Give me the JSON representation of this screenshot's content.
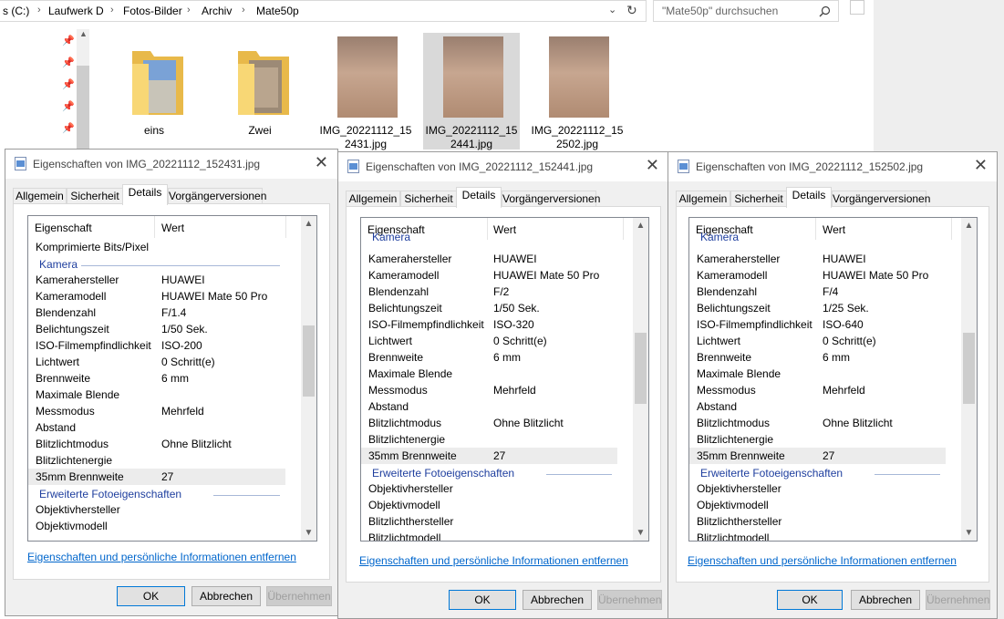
{
  "explorer": {
    "breadcrumb": [
      "s (C:)",
      "Laufwerk D",
      "Fotos-Bilder",
      "Archiv",
      "Mate50p"
    ],
    "search_placeholder": "\"Mate50p\" durchsuchen",
    "files": [
      {
        "label": "eins",
        "type": "folder"
      },
      {
        "label": "Zwei",
        "type": "folder"
      },
      {
        "label": "IMG_20221112_15\n2431.jpg",
        "type": "image"
      },
      {
        "label": "IMG_20221112_15\n2441.jpg",
        "type": "image",
        "selected": true
      },
      {
        "label": "IMG_20221112_15\n2502.jpg",
        "type": "image"
      }
    ]
  },
  "common": {
    "tabs": [
      "Allgemein",
      "Sicherheit",
      "Details",
      "Vorgängerversionen"
    ],
    "col_property": "Eigenschaft",
    "col_value": "Wert",
    "remove_link": "Eigenschaften und persönliche Informationen entfernen",
    "ok": "OK",
    "cancel": "Abbrechen",
    "apply": "Übernehmen"
  },
  "dialogs": [
    {
      "title": "Eigenschaften von IMG_20221112_152431.jpg",
      "rows": [
        {
          "p": "Komprimierte Bits/Pixel",
          "v": ""
        },
        {
          "group": "Kamera"
        },
        {
          "p": "Kamerahersteller",
          "v": "HUAWEI"
        },
        {
          "p": "Kameramodell",
          "v": "HUAWEI Mate 50 Pro"
        },
        {
          "p": "Blendenzahl",
          "v": "F/1.4"
        },
        {
          "p": "Belichtungszeit",
          "v": "1/50 Sek."
        },
        {
          "p": "ISO-Filmempfindlichkeit",
          "v": "ISO-200"
        },
        {
          "p": "Lichtwert",
          "v": "0 Schritt(e)"
        },
        {
          "p": "Brennweite",
          "v": "6 mm"
        },
        {
          "p": "Maximale Blende",
          "v": ""
        },
        {
          "p": "Messmodus",
          "v": "Mehrfeld"
        },
        {
          "p": "Abstand",
          "v": ""
        },
        {
          "p": "Blitzlichtmodus",
          "v": "Ohne Blitzlicht"
        },
        {
          "p": "Blitzlichtenergie",
          "v": ""
        },
        {
          "p": "35mm Brennweite",
          "v": "27",
          "hl": true
        },
        {
          "group": "Erweiterte Fotoeigenschaften"
        },
        {
          "p": "Objektivhersteller",
          "v": ""
        },
        {
          "p": "Objektivmodell",
          "v": ""
        }
      ]
    },
    {
      "title": "Eigenschaften von IMG_20221112_152441.jpg",
      "rows": [
        {
          "group": "Kamera",
          "clipped": true
        },
        {
          "p": "Kamerahersteller",
          "v": "HUAWEI"
        },
        {
          "p": "Kameramodell",
          "v": "HUAWEI Mate 50 Pro"
        },
        {
          "p": "Blendenzahl",
          "v": "F/2"
        },
        {
          "p": "Belichtungszeit",
          "v": "1/50 Sek."
        },
        {
          "p": "ISO-Filmempfindlichkeit",
          "v": "ISO-320"
        },
        {
          "p": "Lichtwert",
          "v": "0 Schritt(e)"
        },
        {
          "p": "Brennweite",
          "v": "6 mm"
        },
        {
          "p": "Maximale Blende",
          "v": ""
        },
        {
          "p": "Messmodus",
          "v": "Mehrfeld"
        },
        {
          "p": "Abstand",
          "v": ""
        },
        {
          "p": "Blitzlichtmodus",
          "v": "Ohne Blitzlicht"
        },
        {
          "p": "Blitzlichtenergie",
          "v": ""
        },
        {
          "p": "35mm Brennweite",
          "v": "27",
          "hl": true
        },
        {
          "group": "Erweiterte Fotoeigenschaften"
        },
        {
          "p": "Objektivhersteller",
          "v": ""
        },
        {
          "p": "Objektivmodell",
          "v": ""
        },
        {
          "p": "Blitzlichthersteller",
          "v": ""
        },
        {
          "p": "Blitzlichtmodell",
          "v": ""
        }
      ]
    },
    {
      "title": "Eigenschaften von IMG_20221112_152502.jpg",
      "rows": [
        {
          "group": "Kamera",
          "clipped": true
        },
        {
          "p": "Kamerahersteller",
          "v": "HUAWEI"
        },
        {
          "p": "Kameramodell",
          "v": "HUAWEI Mate 50 Pro"
        },
        {
          "p": "Blendenzahl",
          "v": "F/4"
        },
        {
          "p": "Belichtungszeit",
          "v": "1/25 Sek."
        },
        {
          "p": "ISO-Filmempfindlichkeit",
          "v": "ISO-640"
        },
        {
          "p": "Lichtwert",
          "v": "0 Schritt(e)"
        },
        {
          "p": "Brennweite",
          "v": "6 mm"
        },
        {
          "p": "Maximale Blende",
          "v": ""
        },
        {
          "p": "Messmodus",
          "v": "Mehrfeld"
        },
        {
          "p": "Abstand",
          "v": ""
        },
        {
          "p": "Blitzlichtmodus",
          "v": "Ohne Blitzlicht"
        },
        {
          "p": "Blitzlichtenergie",
          "v": ""
        },
        {
          "p": "35mm Brennweite",
          "v": "27",
          "hl": true
        },
        {
          "group": "Erweiterte Fotoeigenschaften"
        },
        {
          "p": "Objektivhersteller",
          "v": ""
        },
        {
          "p": "Objektivmodell",
          "v": ""
        },
        {
          "p": "Blitzlichthersteller",
          "v": ""
        },
        {
          "p": "Blitzlichtmodell",
          "v": ""
        }
      ]
    }
  ],
  "colors": {
    "accent": "#0078d7",
    "group_text": "#1e3e9e",
    "link": "#0066cc",
    "folder": "#f8d775"
  }
}
